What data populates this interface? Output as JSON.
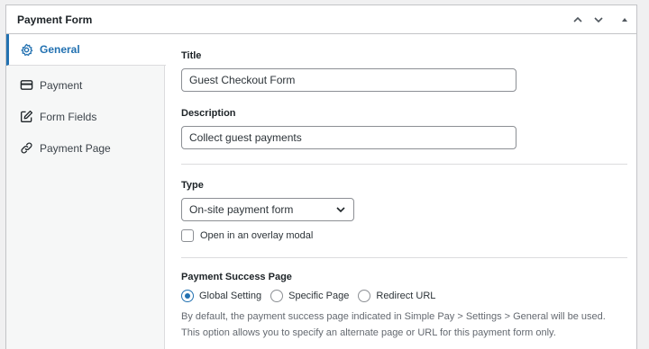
{
  "panel": {
    "title": "Payment Form"
  },
  "sidebar": {
    "items": [
      {
        "label": "General",
        "icon": "gear-icon",
        "active": true
      },
      {
        "label": "Payment",
        "icon": "credit-card-icon",
        "active": false
      },
      {
        "label": "Form Fields",
        "icon": "edit-icon",
        "active": false
      },
      {
        "label": "Payment Page",
        "icon": "link-icon",
        "active": false
      }
    ]
  },
  "general": {
    "title_label": "Title",
    "title_value": "Guest Checkout Form",
    "description_label": "Description",
    "description_value": "Collect guest payments",
    "type_label": "Type",
    "type_value": "On-site payment form",
    "overlay_label": "Open in an overlay modal",
    "overlay_checked": false,
    "success_label": "Payment Success Page",
    "success_options": [
      "Global Setting",
      "Specific Page",
      "Redirect URL"
    ],
    "success_selected": "Global Setting",
    "help_line1": "By default, the payment success page indicated in Simple Pay > Settings > General will be used.",
    "help_line2": "This option allows you to specify an alternate page or URL for this payment form only."
  },
  "colors": {
    "accent": "#2271b1",
    "border": "#c3c4c7",
    "background": "#f0f0f1"
  }
}
